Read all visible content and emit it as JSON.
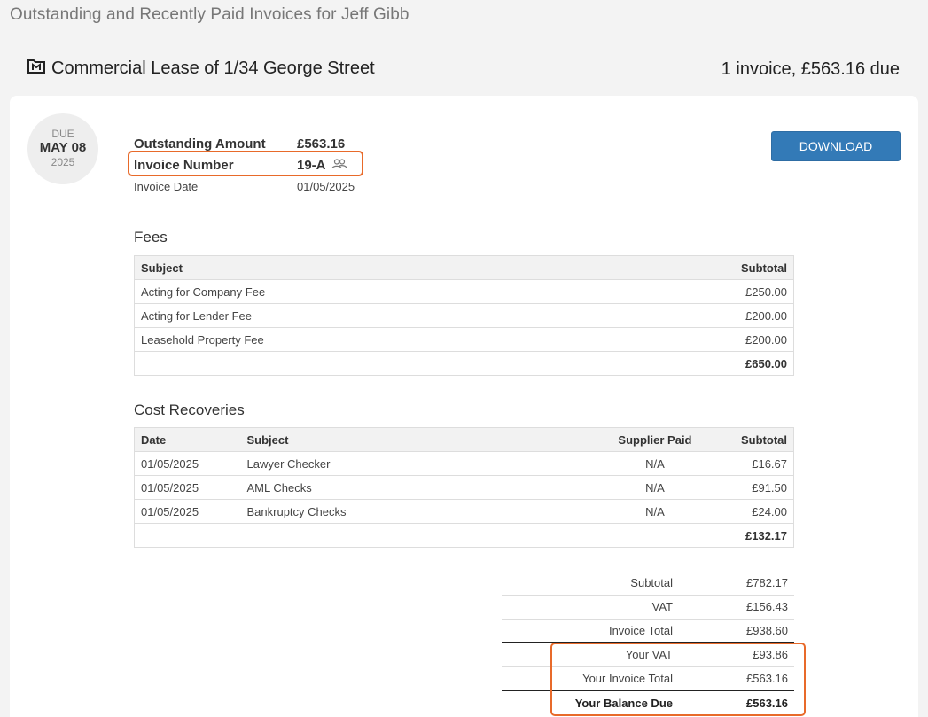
{
  "page_title": "Outstanding and Recently Paid Invoices for Jeff Gibb",
  "matter": {
    "title": "Commercial Lease of 1/34 George Street",
    "summary": "1 invoice, £563.16 due",
    "icon": "matter-icon"
  },
  "due": {
    "label": "DUE",
    "day": "MAY 08",
    "year": "2025"
  },
  "invoice": {
    "outstanding_label": "Outstanding Amount",
    "outstanding_value": "£563.16",
    "number_label": "Invoice Number",
    "number_value": "19-A",
    "date_label": "Invoice Date",
    "date_value": "01/05/2025"
  },
  "download_label": "DOWNLOAD",
  "fees": {
    "title": "Fees",
    "headers": {
      "subject": "Subject",
      "subtotal": "Subtotal"
    },
    "rows": [
      {
        "subject": "Acting for Company Fee",
        "subtotal": "£250.00"
      },
      {
        "subject": "Acting for Lender Fee",
        "subtotal": "£200.00"
      },
      {
        "subject": "Leasehold Property Fee",
        "subtotal": "£200.00"
      }
    ],
    "total": "£650.00"
  },
  "costs": {
    "title": "Cost Recoveries",
    "headers": {
      "date": "Date",
      "subject": "Subject",
      "supplier_paid": "Supplier Paid",
      "subtotal": "Subtotal"
    },
    "rows": [
      {
        "date": "01/05/2025",
        "subject": "Lawyer Checker",
        "supplier_paid": "N/A",
        "subtotal": "£16.67"
      },
      {
        "date": "01/05/2025",
        "subject": "AML Checks",
        "supplier_paid": "N/A",
        "subtotal": "£91.50"
      },
      {
        "date": "01/05/2025",
        "subject": "Bankruptcy Checks",
        "supplier_paid": "N/A",
        "subtotal": "£24.00"
      }
    ],
    "total": "£132.17"
  },
  "totals": {
    "subtotal_label": "Subtotal",
    "subtotal_value": "£782.17",
    "vat_label": "VAT",
    "vat_value": "£156.43",
    "invoice_total_label": "Invoice Total",
    "invoice_total_value": "£938.60",
    "your_vat_label": "Your VAT",
    "your_vat_value": "£93.86",
    "your_invoice_total_label": "Your Invoice Total",
    "your_invoice_total_value": "£563.16",
    "balance_label": "Your Balance Due",
    "balance_value": "£563.16"
  },
  "colors": {
    "highlight": "#e86a2a",
    "button": "#337ab7"
  }
}
